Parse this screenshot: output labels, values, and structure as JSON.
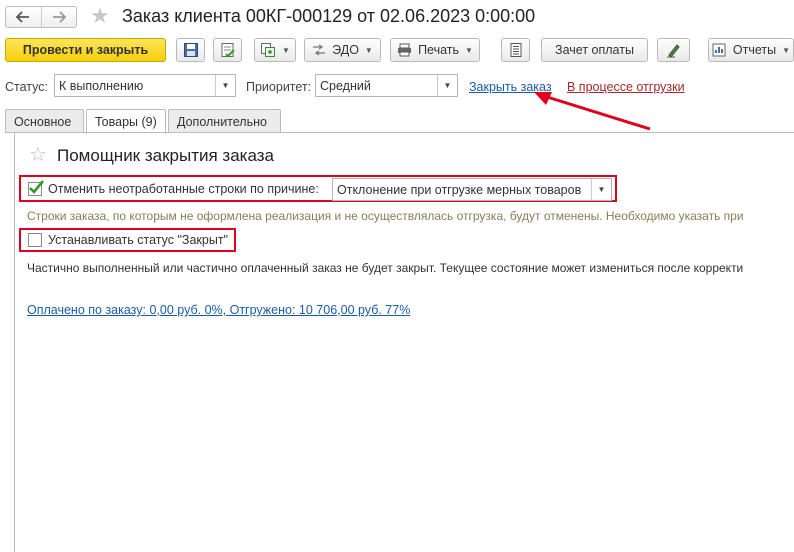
{
  "window": {
    "title": "Заказ клиента 00КГ-000129 от 02.06.2023 0:00:00"
  },
  "toolbar": {
    "post_close_label": "Провести и закрыть",
    "edo_label": "ЭДО",
    "print_label": "Печать",
    "payment_offset_label": "Зачет оплаты",
    "reports_label": "Отчеты"
  },
  "status_row": {
    "status_label": "Статус:",
    "status_value": "К выполнению",
    "priority_label": "Приоритет:",
    "priority_value": "Средний",
    "close_order_link": "Закрыть заказ",
    "shipping_link": "В процессе отгрузки"
  },
  "tabs": [
    {
      "label": "Основное"
    },
    {
      "label": "Товары (9)"
    },
    {
      "label": "Дополнительно"
    }
  ],
  "assistant": {
    "title": "Помощник закрытия заказа",
    "cancel_rows_label": "Отменить неотработанные строки по причине:",
    "cancel_rows_checked": true,
    "reason_value": "Отклонение при отгрузке мерных товаров",
    "cancel_hint": "Строки заказа, по которым не оформлена реализация и не осуществлялась отгрузка, будут отменены. Необходимо указать при",
    "set_closed_label": "Устанавливать статус \"Закрыт\"",
    "set_closed_checked": false,
    "partial_note": "Частично выполненный или частично оплаченный заказ не будет закрыт. Текущее состояние может измениться после корректи",
    "summary_link": "Оплачено по заказу: 0,00  руб.  0%, Отгружено: 10 706,00 руб.  77%"
  },
  "colors": {
    "primary_button": "#f5cf0a",
    "highlight": "#e0001b",
    "link": "#1a5ca8",
    "link_red": "#a52a2a",
    "hint_text": "#8a7d55"
  },
  "icons": [
    "back-arrow-icon",
    "forward-arrow-icon",
    "favorite-star-icon",
    "save-icon",
    "post-icon",
    "create-based-icon",
    "edo-icon",
    "printer-icon",
    "list-icon",
    "sign-icon",
    "reports-icon",
    "checkmark-icon",
    "dropdown-arrow-icon"
  ]
}
